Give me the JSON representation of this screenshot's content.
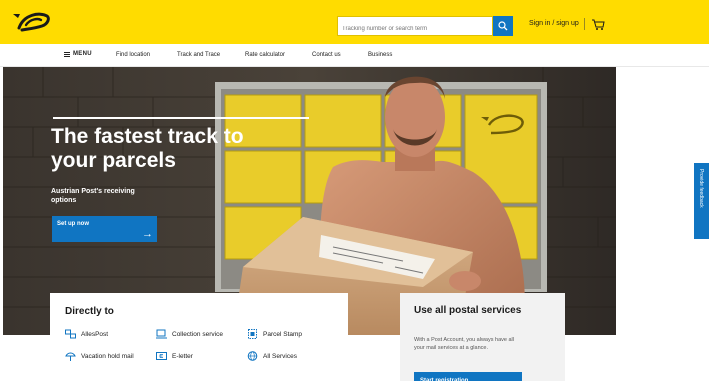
{
  "header": {
    "search_placeholder": "Tracking number or search term",
    "signin_label": "Sign in / sign up"
  },
  "nav": {
    "menu_label": "MENU",
    "items": [
      {
        "label": "Find location"
      },
      {
        "label": "Track and Trace"
      },
      {
        "label": "Rate calculator"
      },
      {
        "label": "Contact us"
      },
      {
        "label": "Business"
      }
    ]
  },
  "hero": {
    "title": "The fastest track to your parcels",
    "subtitle": "Austrian Post's receiving options",
    "cta_label": "Set up now",
    "cta_arrow": "→"
  },
  "directly": {
    "heading": "Directly to",
    "links": [
      {
        "label": "AllesPost",
        "icon": "allespost-icon"
      },
      {
        "label": "Collection service",
        "icon": "collection-service-icon"
      },
      {
        "label": "Parcel Stamp",
        "icon": "parcel-stamp-icon"
      },
      {
        "label": "Vacation hold mail",
        "icon": "vacation-hold-icon"
      },
      {
        "label": "E-letter",
        "icon": "e-letter-icon"
      },
      {
        "label": "All Services",
        "icon": "globe-icon"
      }
    ]
  },
  "postal": {
    "heading": "Use all postal services",
    "text": "With a Post Account, you always have all your mail services at a glance.",
    "button_label": "Start registration"
  },
  "feedback": {
    "label": "Provide feedback"
  },
  "colors": {
    "brand_yellow": "#ffdc00",
    "accent_blue": "#1075c2"
  }
}
